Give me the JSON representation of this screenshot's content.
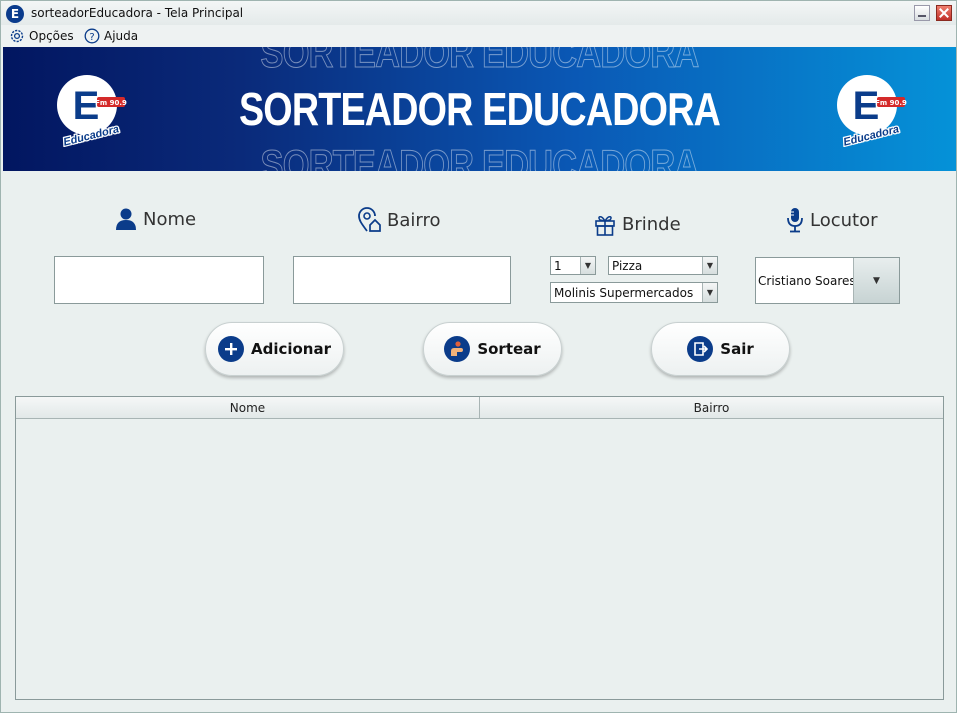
{
  "window": {
    "title": "sorteadorEducadora - Tela Principal",
    "icon": "educadora-logo-icon"
  },
  "menu": [
    {
      "label": "Opções",
      "icon": "gear-icon"
    },
    {
      "label": "Ajuda",
      "icon": "help-circle-icon"
    }
  ],
  "banner": {
    "title": "SORTEADOR EDUCADORA",
    "logo_letter": "E",
    "logo_name": "Educadora",
    "logo_freq": "Fm 90.9"
  },
  "form": {
    "nome": {
      "label": "Nome",
      "icon": "user-icon",
      "value": ""
    },
    "bairro": {
      "label": "Bairro",
      "icon": "location-home-icon",
      "value": ""
    },
    "brinde": {
      "label": "Brinde",
      "icon": "gift-icon",
      "quantity": "1",
      "item": "Pizza",
      "sponsor": "Molinis Supermercados"
    },
    "locutor": {
      "label": "Locutor",
      "icon": "microphone-icon",
      "value": "Cristiano Soares"
    }
  },
  "buttons": {
    "adicionar": "Adicionar",
    "sortear": "Sortear",
    "sair": "Sair"
  },
  "table": {
    "columns": [
      "Nome",
      "Bairro"
    ],
    "rows": []
  },
  "colors": {
    "accent": "#0b3c8a",
    "banner_left": "#021660",
    "banner_right": "#0592d8"
  }
}
